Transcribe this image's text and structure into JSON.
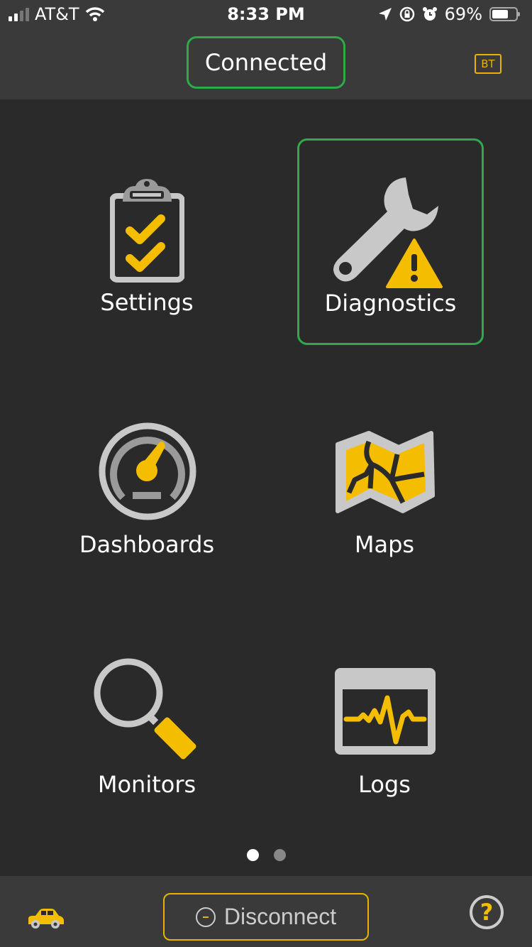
{
  "status_bar": {
    "carrier": "AT&T",
    "time": "8:33 PM",
    "battery_percent": "69%",
    "battery_level": 0.69,
    "icons": [
      "signal-icon",
      "wifi-icon",
      "location-icon",
      "rotation-lock-icon",
      "alarm-icon",
      "battery-icon"
    ]
  },
  "header": {
    "connection_status": "Connected",
    "bt_badge": "BT"
  },
  "tiles": [
    {
      "label": "Settings",
      "icon": "clipboard-checklist-icon",
      "selected": false
    },
    {
      "label": "Diagnostics",
      "icon": "wrench-warning-icon",
      "selected": true
    },
    {
      "label": "Dashboards",
      "icon": "gauge-icon",
      "selected": false
    },
    {
      "label": "Maps",
      "icon": "map-icon",
      "selected": false
    },
    {
      "label": "Monitors",
      "icon": "magnifier-icon",
      "selected": false
    },
    {
      "label": "Logs",
      "icon": "log-waveform-icon",
      "selected": false
    }
  ],
  "pagination": {
    "current_page": 1,
    "total_pages": 2
  },
  "bottom_bar": {
    "disconnect_label": "Disconnect",
    "help_label": "?",
    "vehicle_icon": "car-icon"
  },
  "colors": {
    "accent": "#f5bd00",
    "connected_green": "#2eaa4a",
    "background": "#2a2a2a",
    "bar": "#3a3a3a",
    "icon_gray": "#c8c8c8"
  }
}
